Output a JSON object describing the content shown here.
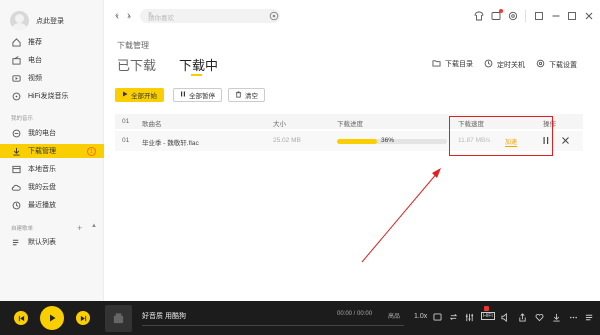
{
  "sidebar": {
    "login": "点此登录",
    "items": [
      {
        "label": "推荐",
        "icon": "home-icon"
      },
      {
        "label": "电台",
        "icon": "radio-icon"
      },
      {
        "label": "视频",
        "icon": "video-icon"
      },
      {
        "label": "HiFi发烧音乐",
        "icon": "hifi-icon"
      }
    ],
    "my_music_title": "我的音乐",
    "my_items": [
      {
        "label": "我的电台",
        "icon": "my-radio-icon"
      },
      {
        "label": "下载管理",
        "icon": "download-icon",
        "badge": "1"
      },
      {
        "label": "本地音乐",
        "icon": "local-music-icon"
      },
      {
        "label": "我的云盘",
        "icon": "cloud-icon"
      },
      {
        "label": "最近播放",
        "icon": "recent-icon"
      }
    ],
    "playlists_title": "自建歌单",
    "playlist_items": [
      {
        "label": "默认列表",
        "icon": "playlist-icon"
      }
    ]
  },
  "topbar": {
    "search_placeholder": "猜你喜欢"
  },
  "main": {
    "title": "下载管理",
    "tab_done": "已下载",
    "tab_downloading": "下载中",
    "tools": {
      "dir": "下载目录",
      "shutdown": "定时关机",
      "settings": "下载设置"
    },
    "buttons": {
      "start_all": "全部开始",
      "pause_all": "全部暂停",
      "clear": "清空"
    },
    "table": {
      "headers": {
        "num": "01",
        "name": "歌曲名",
        "size": "大小",
        "progress": "下载进度",
        "speed": "下载速度",
        "actions": "操作"
      },
      "rows": [
        {
          "num": "01",
          "name": "毕业季 - 魏敬轩.flac",
          "size": "25.02 MB",
          "progress": 0.36,
          "progress_text": "36%",
          "speed": "11.87 MB/s",
          "speed_action": "加速"
        }
      ]
    }
  },
  "player": {
    "song": "好音质 用酷狗",
    "time": "00:00 / 00:00",
    "quality": "高品",
    "speed": "1.0x",
    "hifi": "HiFi",
    "accent": "#f9cf01"
  }
}
